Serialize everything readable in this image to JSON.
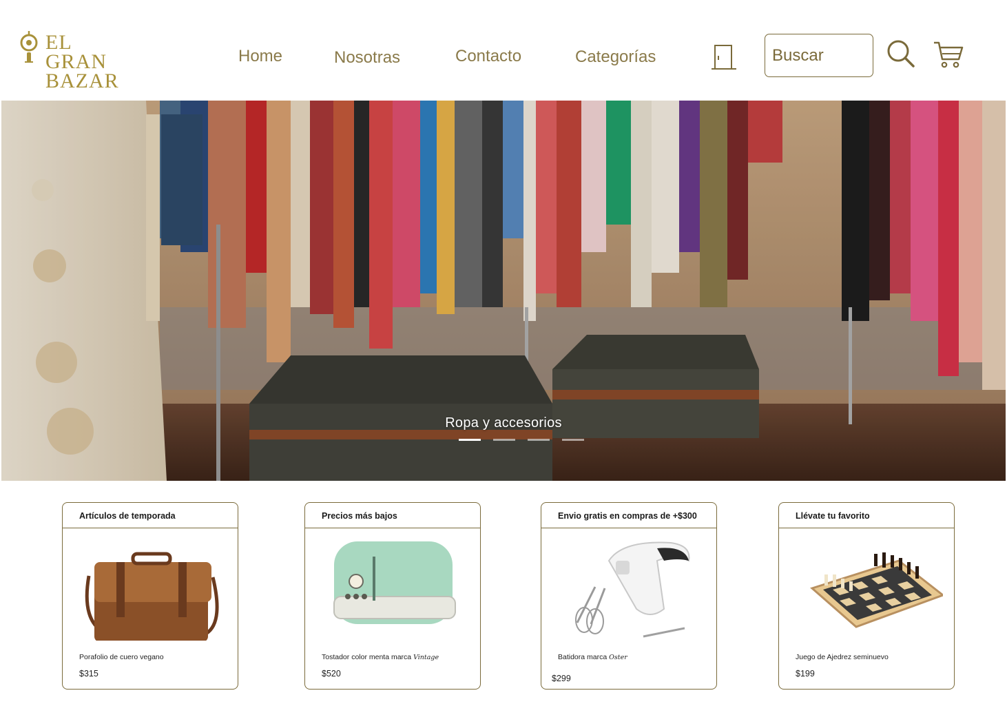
{
  "brand": {
    "line1": "EL",
    "line2": "GRAN BAZAR",
    "color": "#a8913a"
  },
  "nav": {
    "links": [
      "Home",
      "Nosotras",
      "Contacto",
      "Categorías"
    ]
  },
  "icons": {
    "login": "door-icon",
    "search": "search-icon",
    "cart": "cart-icon"
  },
  "search": {
    "placeholder": "Buscar"
  },
  "hero": {
    "caption": "Ropa y accesorios",
    "slides": 4,
    "active_slide": 1
  },
  "cards": [
    {
      "header": "Artículos de temporada",
      "name": "Porafolio de cuero vegano",
      "brand": "",
      "price": "$315"
    },
    {
      "header": "Precios más bajos",
      "name": "Tostador color menta marca ",
      "brand": "Vintage",
      "price": "$520"
    },
    {
      "header": "Envio gratis en compras de +$300",
      "name": "Batidora marca ",
      "brand": "Oster",
      "price": "$299"
    },
    {
      "header": "Llévate tu favorito",
      "name": "Juego de Ajedrez seminuevo",
      "brand": "",
      "price": "$199"
    }
  ],
  "colors": {
    "accent": "#7a6a3a",
    "nav_text": "#8a7a4a"
  }
}
